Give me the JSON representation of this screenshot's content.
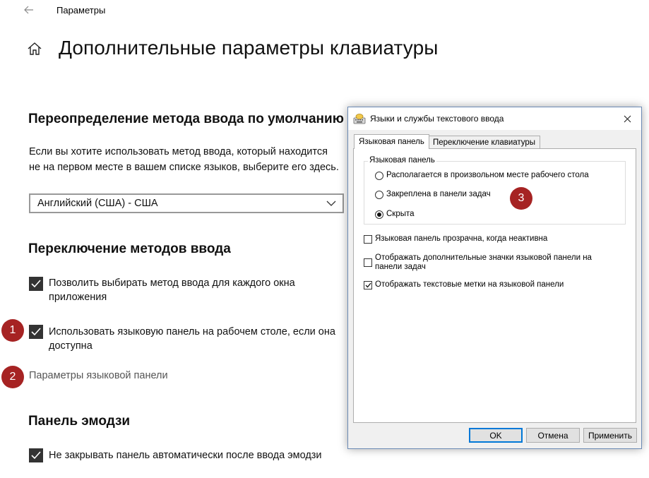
{
  "window": {
    "title": "Параметры"
  },
  "page": {
    "title": "Дополнительные параметры клавиатуры"
  },
  "override": {
    "title": "Переопределение метода ввода по умолчанию",
    "description": "Если вы хотите использовать метод ввода, который находится не на первом месте в вашем списке языков, выберите его здесь.",
    "selected_value": "Английский (США) - США"
  },
  "switching": {
    "title": "Переключение методов ввода",
    "items": [
      {
        "label": "Позволить выбирать метод ввода для каждого окна приложения",
        "checked": true
      },
      {
        "label": "Использовать языковую панель на рабочем столе, если она доступна",
        "checked": true
      }
    ],
    "link": "Параметры языковой панели"
  },
  "emoji": {
    "title": "Панель эмодзи",
    "items": [
      {
        "label": "Не закрывать панель автоматически после ввода эмодзи",
        "checked": true
      }
    ]
  },
  "badges": [
    "1",
    "2",
    "3"
  ],
  "dialog": {
    "title": "Языки и службы текстового ввода",
    "tabs": [
      "Языковая панель",
      "Переключение клавиатуры"
    ],
    "active_tab": 0,
    "group_label": "Языковая панель",
    "radios": [
      {
        "label": "Располагается в произвольном месте рабочего стола",
        "selected": false
      },
      {
        "label": "Закреплена в панели задач",
        "selected": false
      },
      {
        "label": "Скрыта",
        "selected": true
      }
    ],
    "checks": [
      {
        "label": "Языковая панель прозрачна, когда неактивна",
        "checked": false
      },
      {
        "label": "Отображать дополнительные значки языковой панели на панели задач",
        "checked": false
      },
      {
        "label": "Отображать текстовые метки на языковой панели",
        "checked": true
      }
    ],
    "buttons": {
      "ok": "OK",
      "cancel": "Отмена",
      "apply": "Применить"
    }
  },
  "colors": {
    "badge": "#a62323",
    "checkbox": "#333333",
    "accent": "#0078d7"
  }
}
